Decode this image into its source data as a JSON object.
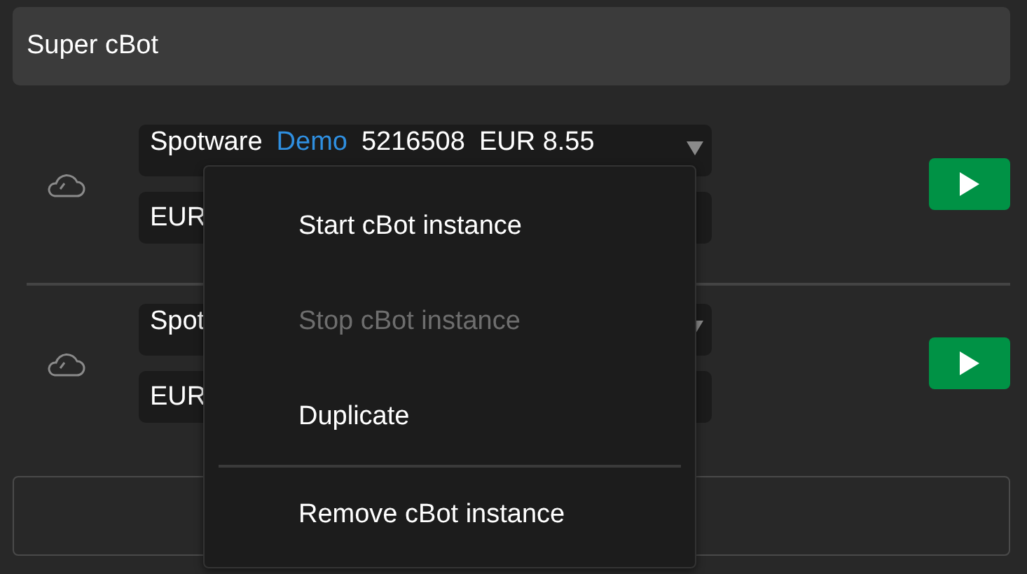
{
  "title": "Super cBot",
  "instances": [
    {
      "account": [
        {
          "text": "Spotware",
          "kind": "plain"
        },
        {
          "text": "Demo",
          "kind": "link"
        },
        {
          "text": "5216508",
          "kind": "plain"
        },
        {
          "text": "EUR 8.55",
          "kind": "plain"
        }
      ],
      "symbol": "EUR"
    },
    {
      "account": [
        {
          "text": "Spot",
          "kind": "plain"
        }
      ],
      "symbol": "EUR"
    }
  ],
  "context_menu": [
    {
      "label": "Start cBot instance",
      "disabled": false
    },
    {
      "label": "Stop cBot instance",
      "disabled": true
    },
    {
      "label": "Duplicate",
      "disabled": false
    },
    {
      "kind": "separator"
    },
    {
      "label": "Remove cBot instance",
      "disabled": false
    }
  ]
}
